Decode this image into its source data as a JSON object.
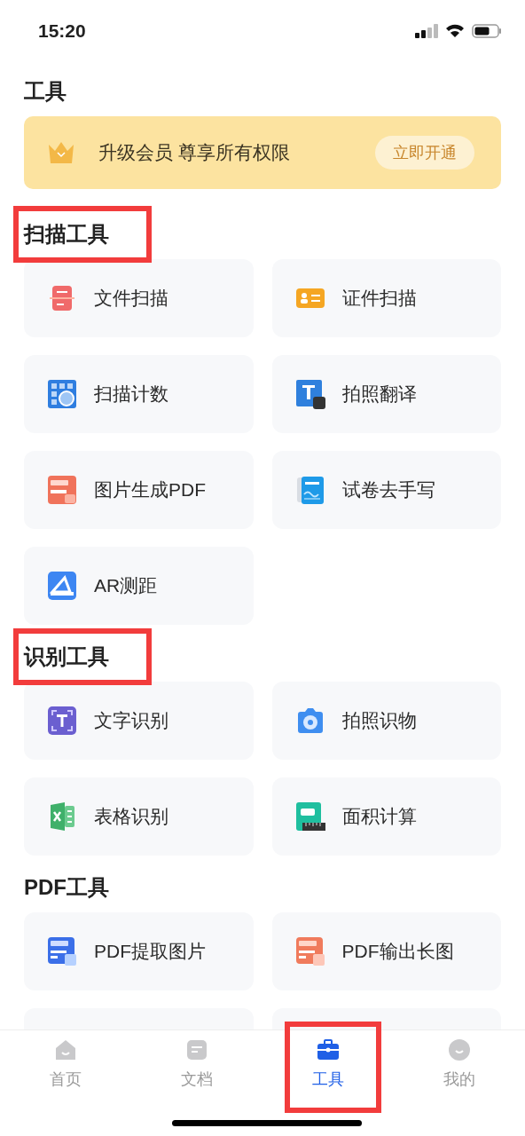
{
  "status_bar": {
    "time": "15:20"
  },
  "title": "工具",
  "banner": {
    "text": "升级会员 尊享所有权限",
    "button": "立即开通"
  },
  "sections": [
    {
      "title": "扫描工具",
      "highlighted": true,
      "items": [
        "文件扫描",
        "证件扫描",
        "扫描计数",
        "拍照翻译",
        "图片生成PDF",
        "试卷去手写",
        "AR测距"
      ]
    },
    {
      "title": "识别工具",
      "highlighted": true,
      "items": [
        "文字识别",
        "拍照识物",
        "表格识别",
        "面积计算"
      ]
    },
    {
      "title": "PDF工具",
      "highlighted": false,
      "items": [
        "PDF提取图片",
        "PDF输出长图"
      ]
    }
  ],
  "tabs": [
    {
      "label": "首页",
      "selected": false,
      "highlighted": false
    },
    {
      "label": "文档",
      "selected": false,
      "highlighted": false
    },
    {
      "label": "工具",
      "selected": true,
      "highlighted": true
    },
    {
      "label": "我的",
      "selected": false,
      "highlighted": false
    }
  ]
}
